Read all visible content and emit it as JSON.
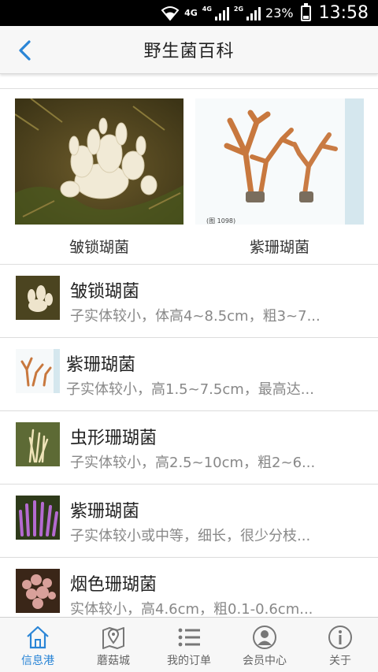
{
  "status_bar": {
    "network_small": "4G",
    "network_main": "4G",
    "network_2g": "2G",
    "battery_percent": "23%",
    "time": "13:58"
  },
  "header": {
    "title": "野生菌百科",
    "back_icon": "chevron-left-icon"
  },
  "featured": [
    {
      "label": "皱锁瑚菌"
    },
    {
      "label": "紫珊瑚菌",
      "image_caption": "(图 1098)"
    }
  ],
  "list": [
    {
      "title": "皱锁瑚菌",
      "desc": "子实体较小，体高4~8.5cm，粗3~7..."
    },
    {
      "title": "紫珊瑚菌",
      "desc": "子实体较小，高1.5~7.5cm，最高达..."
    },
    {
      "title": "虫形珊瑚菌",
      "desc": "子实体较小，高2.5~10cm，粗2~6..."
    },
    {
      "title": "紫珊瑚菌",
      "desc": "子实体较小或中等，细长，很少分枝..."
    },
    {
      "title": "烟色珊瑚菌",
      "desc": "实体较小，高4.6cm，粗0.1-0.6cm..."
    }
  ],
  "tabs": [
    {
      "label": "信息港",
      "icon": "home-icon",
      "active": true
    },
    {
      "label": "蘑菇城",
      "icon": "map-pin-icon",
      "active": false
    },
    {
      "label": "我的订单",
      "icon": "list-icon",
      "active": false
    },
    {
      "label": "会员中心",
      "icon": "user-icon",
      "active": false
    },
    {
      "label": "关于",
      "icon": "info-icon",
      "active": false
    }
  ],
  "colors": {
    "accent": "#2a85d6",
    "header_bg": "#f7f7f7",
    "status_bar_bg": "#000000"
  }
}
